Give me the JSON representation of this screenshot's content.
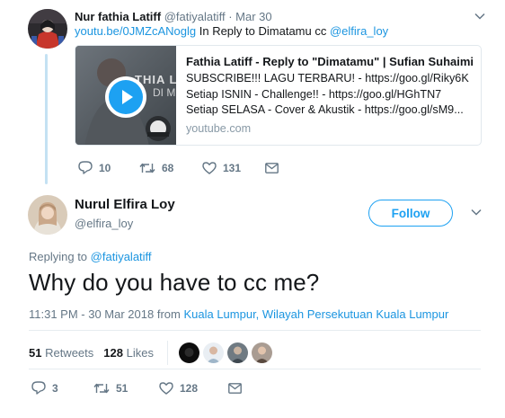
{
  "parent_tweet": {
    "author_name": "Nur fathia Latiff",
    "author_handle": "@fatiyalatiff",
    "dot": "·",
    "date": "Mar 30",
    "link": "youtu.be/0JMZcANoglg",
    "reply_text": " In Reply to Dimatamu cc ",
    "mention": "@elfira_loy",
    "card": {
      "thumb_text": "THIA L",
      "thumb_subtext": "DI M",
      "title": "Fathia Latiff - Reply to \"Dimatamu\" | Sufian Suhaimi",
      "desc_line1": "SUBSCRIBE!!! LAGU TERBARU! - https://goo.gl/Riky6K",
      "desc_line2": "Setiap ISNIN - Challenge!! - https://goo.gl/HGhTN7",
      "desc_line3": "Setiap SELASA - Cover & Akustik - https://goo.gl/sM9...",
      "domain": "youtube.com"
    },
    "actions": {
      "replies": "10",
      "retweets": "68",
      "likes": "131"
    }
  },
  "main_tweet": {
    "author_name": "Nurul Elfira Loy",
    "author_handle": "@elfira_loy",
    "follow_label": "Follow",
    "replying_label": "Replying to ",
    "replying_handle": "@fatiyalatiff",
    "text": "Why do you have to cc me?",
    "time": "11:31 PM - 30 Mar 2018 from ",
    "location": "Kuala Lumpur, Wilayah Persekutuan Kuala Lumpur",
    "stats": {
      "retweets_count": "51",
      "retweets_label": " Retweets",
      "likes_count": "128",
      "likes_label": " Likes"
    },
    "actions": {
      "replies": "3",
      "retweets": "51",
      "likes": "128"
    }
  },
  "icons": [
    "reply-icon",
    "retweet-icon",
    "like-icon",
    "message-icon",
    "chevron-down-icon",
    "play-icon"
  ],
  "colors": {
    "link": "#1b95e0",
    "accent": "#1da1f2",
    "muted": "#657786",
    "thread_line": "#c4e1f3",
    "play_button": "#1da1f2"
  }
}
